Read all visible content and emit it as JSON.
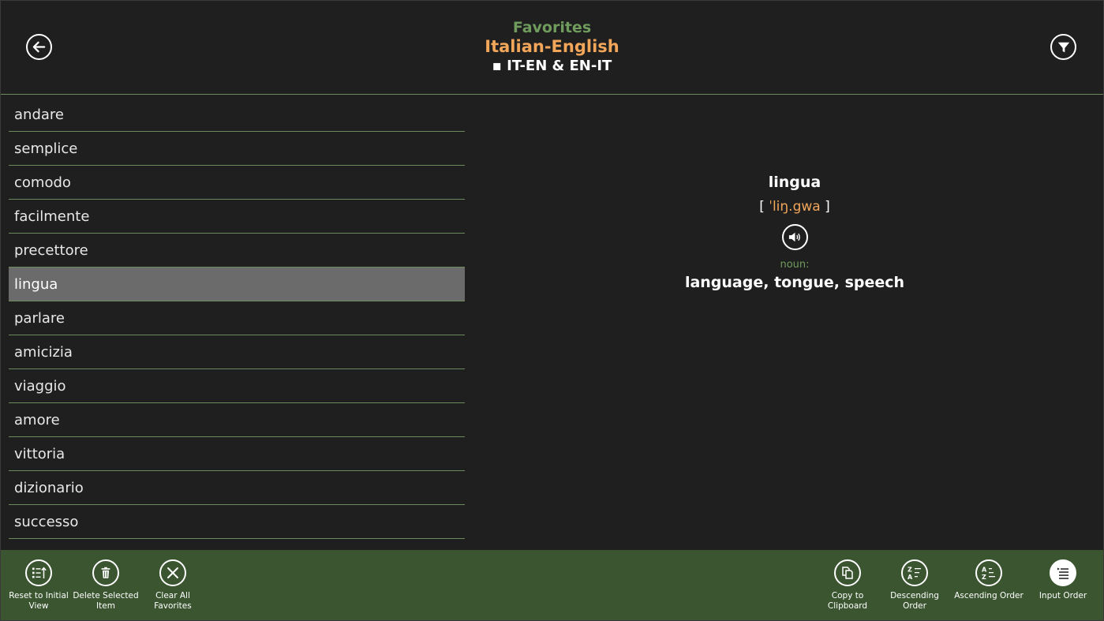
{
  "header": {
    "title": "Favorites",
    "subtitle": "Italian-English",
    "mode": "▪ IT-EN & EN-IT"
  },
  "icons": {
    "back": "back-arrow-icon",
    "filter": "filter-icon",
    "speaker": "speaker-icon"
  },
  "words": [
    {
      "label": "andare"
    },
    {
      "label": "semplice"
    },
    {
      "label": "comodo"
    },
    {
      "label": "facilmente"
    },
    {
      "label": "precettore"
    },
    {
      "label": "lingua"
    },
    {
      "label": "parlare"
    },
    {
      "label": "amicizia"
    },
    {
      "label": "viaggio"
    },
    {
      "label": "amore"
    },
    {
      "label": "vittoria"
    },
    {
      "label": "dizionario"
    },
    {
      "label": "successo"
    }
  ],
  "selected_index": 5,
  "detail": {
    "word": "lingua",
    "bracket_open": "[ ",
    "pronunciation": "ˈliŋ.gwa",
    "bracket_close": " ]",
    "part_of_speech": "noun:",
    "meaning": "language, tongue, speech"
  },
  "appbar": {
    "left": [
      {
        "label": "Reset to Initial View",
        "icon": "reset-list-icon"
      },
      {
        "label": "Delete Selected Item",
        "icon": "trash-icon"
      },
      {
        "label": "Clear All Favorites",
        "icon": "x-icon"
      }
    ],
    "right": [
      {
        "label": "Copy to Clipboard",
        "icon": "copy-icon"
      },
      {
        "label": "Descending Order",
        "icon": "sort-descending-icon"
      },
      {
        "label": "Ascending Order",
        "icon": "sort-ascending-icon"
      },
      {
        "label": "Input Order",
        "icon": "list-order-icon"
      }
    ]
  },
  "colors": {
    "background": "#1f1f1f",
    "accent_green": "#6f9c5c",
    "accent_orange": "#f2a65a",
    "appbar": "#3a5530",
    "selected_row": "#6b6b6b"
  }
}
